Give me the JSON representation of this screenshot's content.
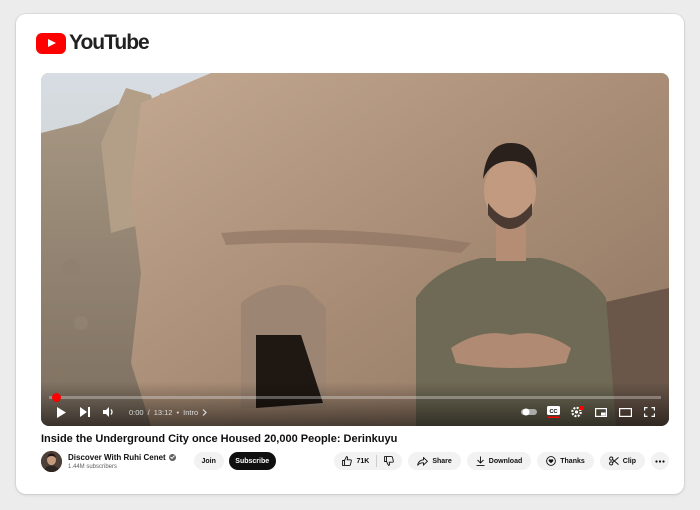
{
  "brand": {
    "logo_text": "YouTube",
    "accent_color": "#ff0000"
  },
  "player": {
    "current_time": "0:00",
    "separator": "/",
    "duration": "13:12",
    "chapter": "Intro",
    "progress_fraction": 0.0,
    "controls": [
      "play-icon",
      "next-icon",
      "volume-icon",
      "autoplay-toggle",
      "captions-icon",
      "settings-icon",
      "miniplayer-icon",
      "theater-icon",
      "fullscreen-icon"
    ]
  },
  "video": {
    "title": "Inside the Underground City once Housed 20,000 People: Derinkuyu"
  },
  "channel": {
    "name": "Discover With Ruhi Cenet",
    "subscribers": "1.44M subscribers",
    "join_label": "Join",
    "subscribe_label": "Subscribe"
  },
  "actions": {
    "like_count": "71K",
    "share_label": "Share",
    "download_label": "Download",
    "thanks_label": "Thanks",
    "clip_label": "Clip"
  }
}
